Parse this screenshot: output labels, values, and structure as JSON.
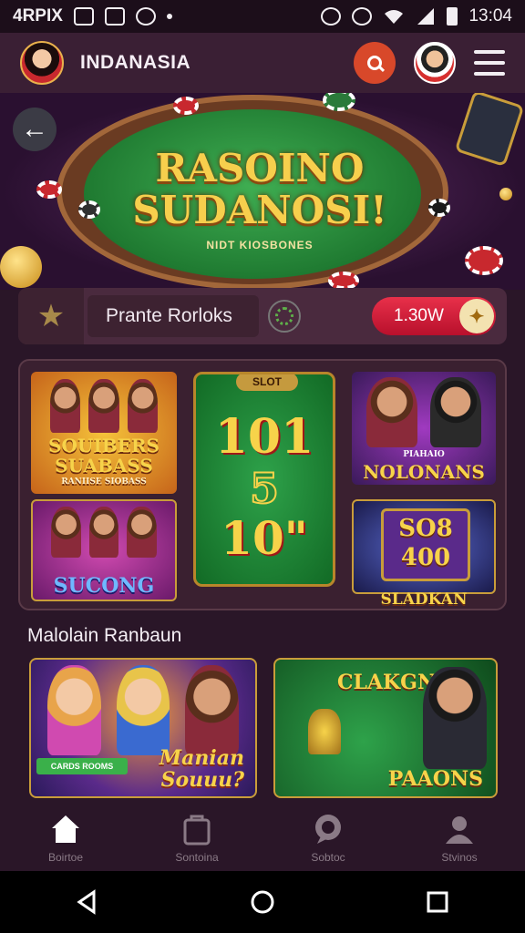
{
  "status_bar": {
    "carrier": "4RPIX",
    "time": "13:04"
  },
  "header": {
    "app_name": "INDANASIA"
  },
  "hero": {
    "title_line1": "RASOINO",
    "title_line2": "SUDANOSI!",
    "subtitle": "NIDT KIOSBONES"
  },
  "promo": {
    "label": "Prante Rorloks",
    "amount": "1.30W"
  },
  "games": {
    "tile1_title_line1": "SOUIBERS",
    "tile1_title_line2": "SUABASS",
    "tile1_sub": "RANIISE SIOBASS",
    "tile2_title": "SUCONG",
    "slot_tag": "SLOT",
    "slot_line1": "101",
    "slot_line2": "5",
    "slot_line3": "10\"",
    "tile3_title": "NOLONANS",
    "tile3_badge": "PIAHAIO",
    "tile4_reels": "SO8 400",
    "tile4_title": "SLADKAN"
  },
  "section": {
    "title": "Malolain Ranbaun"
  },
  "features": {
    "left_title_line1": "Manian",
    "left_title_line2": "Souuu?",
    "left_badge": "CARDS ROOMS",
    "right_title_top": "CLAKGN",
    "right_title_bottom": "PAAONS"
  },
  "bottom_nav": [
    {
      "label": "Boirtoe"
    },
    {
      "label": "Sontoina"
    },
    {
      "label": "Sobtoc"
    },
    {
      "label": "Stvinos"
    }
  ],
  "colors": {
    "accent_red": "#e8304a",
    "gold": "#f7d34a",
    "background": "#2a1628"
  }
}
